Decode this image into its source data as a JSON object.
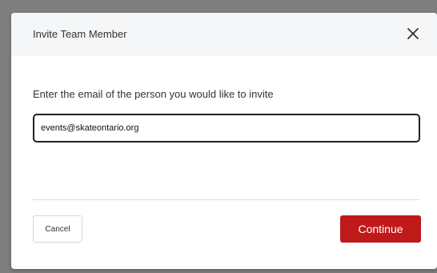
{
  "modal": {
    "title": "Invite Team Member",
    "prompt": "Enter the email of the person you would like to invite",
    "email_value": "events@skateontario.org",
    "cancel_label": "Cancel",
    "continue_label": "Continue"
  },
  "colors": {
    "primary_button": "#c0191a",
    "header_background": "#f5f6f8",
    "backdrop": "#808080"
  },
  "icons": {
    "close": "close-icon"
  }
}
